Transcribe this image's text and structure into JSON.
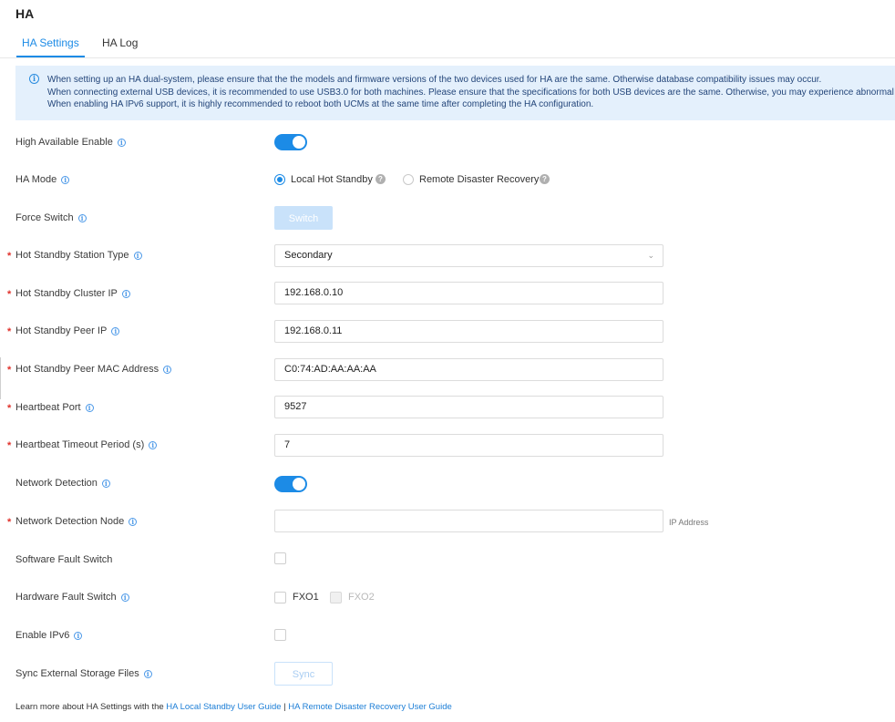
{
  "page": {
    "title": "HA"
  },
  "tabs": [
    {
      "label": "HA Settings",
      "active": true
    },
    {
      "label": "HA Log",
      "active": false
    }
  ],
  "notice": {
    "icon": "info-icon",
    "lines": [
      "When setting up an HA dual-system, please ensure that the the models and firmware versions of the two devices used for HA are the same. Otherwise database compatibility issues may occur.",
      "When connecting external USB devices, it is recommended to use USB3.0 for both machines. Please ensure that the specifications for both USB devices are the same. Otherwise, you may experience abnormal behavior.",
      "When enabling HA IPv6 support, it is highly recommended to reboot both UCMs at the same time after completing the HA configuration."
    ]
  },
  "form": {
    "high_available_enable": {
      "label": "High Available Enable",
      "value": true
    },
    "ha_mode": {
      "label": "HA Mode",
      "options": [
        {
          "label": "Local Hot Standby",
          "selected": true
        },
        {
          "label": "Remote Disaster Recovery",
          "selected": false
        }
      ]
    },
    "force_switch": {
      "label": "Force Switch",
      "button": "Switch"
    },
    "station_type": {
      "label": "Hot Standby Station Type",
      "value": "Secondary",
      "required": true
    },
    "cluster_ip": {
      "label": "Hot Standby Cluster IP",
      "value": "192.168.0.10",
      "required": true
    },
    "peer_ip": {
      "label": "Hot Standby Peer IP",
      "value": "192.168.0.11",
      "required": true
    },
    "peer_mac": {
      "label": "Hot Standby Peer MAC Address",
      "value": "C0:74:AD:AA:AA:AA",
      "required": true
    },
    "heartbeat_port": {
      "label": "Heartbeat Port",
      "value": "9527",
      "required": true
    },
    "heartbeat_timeout": {
      "label": "Heartbeat Timeout Period (s)",
      "value": "7",
      "required": true
    },
    "network_detection": {
      "label": "Network Detection",
      "value": true
    },
    "network_detection_node": {
      "label": "Network Detection Node",
      "value": "",
      "addon": "IP Address",
      "required": true
    },
    "software_fault_switch": {
      "label": "Software Fault Switch",
      "checked": false
    },
    "hardware_fault_switch": {
      "label": "Hardware Fault Switch",
      "options": [
        {
          "label": "FXO1",
          "checked": false,
          "disabled": false
        },
        {
          "label": "FXO2",
          "checked": false,
          "disabled": true
        }
      ]
    },
    "enable_ipv6": {
      "label": "Enable IPv6",
      "checked": false
    },
    "sync_external_storage": {
      "label": "Sync External Storage Files",
      "button": "Sync"
    }
  },
  "footer": {
    "prefix": "Learn more about HA Settings with the ",
    "link1": "HA Local Standby User Guide",
    "separator": " | ",
    "link2": "HA Remote Disaster Recovery User Guide"
  },
  "colors": {
    "accent": "#1c8be6",
    "notice_bg": "#e4f0fc",
    "required": "#e0312b"
  }
}
